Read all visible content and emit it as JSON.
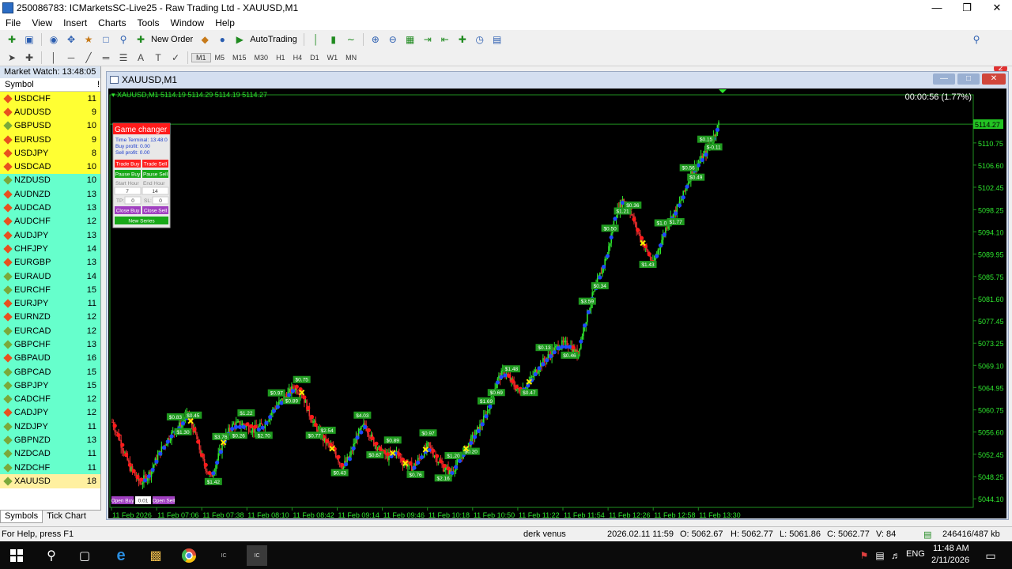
{
  "window": {
    "title": "250086783: ICMarketsSC-Live25 - Raw Trading Ltd - XAUUSD,M1",
    "controls": [
      "minimize",
      "maximize",
      "close"
    ]
  },
  "menu": [
    "File",
    "View",
    "Insert",
    "Charts",
    "Tools",
    "Window",
    "Help"
  ],
  "toolbar": {
    "new_order_label": "New Order",
    "autotrading_label": "AutoTrading",
    "notifications_count": "2"
  },
  "timeframes": [
    "M1",
    "M5",
    "M15",
    "M30",
    "H1",
    "H4",
    "D1",
    "W1",
    "MN"
  ],
  "active_timeframe": "M1",
  "market_watch": {
    "header": "Market Watch: 13:48:05",
    "col_symbol": "Symbol",
    "col_spread": "!",
    "rows": [
      {
        "symbol": "USDCHF",
        "spread": "11",
        "color": "#ffff33",
        "dot": "#e8501e"
      },
      {
        "symbol": "AUDUSD",
        "spread": "9",
        "color": "#ffff33",
        "dot": "#e8501e"
      },
      {
        "symbol": "GBPUSD",
        "spread": "10",
        "color": "#ffff33",
        "dot": "#7aa93a"
      },
      {
        "symbol": "EURUSD",
        "spread": "9",
        "color": "#ffff33",
        "dot": "#e8501e"
      },
      {
        "symbol": "USDJPY",
        "spread": "8",
        "color": "#ffff33",
        "dot": "#e8501e"
      },
      {
        "symbol": "USDCAD",
        "spread": "10",
        "color": "#ffff33",
        "dot": "#e8501e"
      },
      {
        "symbol": "NZDUSD",
        "spread": "10",
        "color": "#66ffcc",
        "dot": "#7aa93a"
      },
      {
        "symbol": "AUDNZD",
        "spread": "13",
        "color": "#66ffcc",
        "dot": "#e8501e"
      },
      {
        "symbol": "AUDCAD",
        "spread": "13",
        "color": "#66ffcc",
        "dot": "#e8501e"
      },
      {
        "symbol": "AUDCHF",
        "spread": "12",
        "color": "#66ffcc",
        "dot": "#e8501e"
      },
      {
        "symbol": "AUDJPY",
        "spread": "13",
        "color": "#66ffcc",
        "dot": "#e8501e"
      },
      {
        "symbol": "CHFJPY",
        "spread": "14",
        "color": "#66ffcc",
        "dot": "#e8501e"
      },
      {
        "symbol": "EURGBP",
        "spread": "13",
        "color": "#66ffcc",
        "dot": "#e8501e"
      },
      {
        "symbol": "EURAUD",
        "spread": "14",
        "color": "#66ffcc",
        "dot": "#7aa93a"
      },
      {
        "symbol": "EURCHF",
        "spread": "15",
        "color": "#66ffcc",
        "dot": "#7aa93a"
      },
      {
        "symbol": "EURJPY",
        "spread": "11",
        "color": "#66ffcc",
        "dot": "#e8501e"
      },
      {
        "symbol": "EURNZD",
        "spread": "12",
        "color": "#66ffcc",
        "dot": "#e8501e"
      },
      {
        "symbol": "EURCAD",
        "spread": "12",
        "color": "#66ffcc",
        "dot": "#7aa93a"
      },
      {
        "symbol": "GBPCHF",
        "spread": "13",
        "color": "#66ffcc",
        "dot": "#7aa93a"
      },
      {
        "symbol": "GBPAUD",
        "spread": "16",
        "color": "#66ffcc",
        "dot": "#e8501e"
      },
      {
        "symbol": "GBPCAD",
        "spread": "15",
        "color": "#66ffcc",
        "dot": "#7aa93a"
      },
      {
        "symbol": "GBPJPY",
        "spread": "15",
        "color": "#66ffcc",
        "dot": "#7aa93a"
      },
      {
        "symbol": "CADCHF",
        "spread": "12",
        "color": "#66ffcc",
        "dot": "#7aa93a"
      },
      {
        "symbol": "CADJPY",
        "spread": "12",
        "color": "#66ffcc",
        "dot": "#e8501e"
      },
      {
        "symbol": "NZDJPY",
        "spread": "11",
        "color": "#66ffcc",
        "dot": "#7aa93a"
      },
      {
        "symbol": "GBPNZD",
        "spread": "13",
        "color": "#66ffcc",
        "dot": "#7aa93a"
      },
      {
        "symbol": "NZDCAD",
        "spread": "11",
        "color": "#66ffcc",
        "dot": "#7aa93a"
      },
      {
        "symbol": "NZDCHF",
        "spread": "11",
        "color": "#66ffcc",
        "dot": "#7aa93a"
      },
      {
        "symbol": "XAUUSD",
        "spread": "18",
        "color": "#fff0a0",
        "dot": "#7aa93a"
      }
    ],
    "tabs": [
      "Symbols",
      "Tick Chart"
    ]
  },
  "chart_window": {
    "title": "XAUUSD,M1",
    "ohlc_line": "XAUUSD,M1  5114.19 5114.29 5114.19 5114.27",
    "timer": "00:00:56 (1.77%)",
    "current_price": "5114.27"
  },
  "panel": {
    "title": "Game changer",
    "time_terminal": "Time Terminal: 13:48:0",
    "buy_profit": "Buy profit: 0.00",
    "sell_profit": "Sell profit: 0.00",
    "trade_buy": "Trade Buy",
    "trade_sell": "Trade Sell",
    "pause_buy": "Pause Buy",
    "pause_sell": "Pause Sell",
    "start_hour_label": "Start Hour",
    "end_hour_label": "End Hour",
    "start_hour": "7",
    "end_hour": "14",
    "tp_label": "TP:",
    "tp_value": "0",
    "sl_label": "SL:",
    "sl_value": "0",
    "close_buy": "Close Buy",
    "close_sell": "Close Sell",
    "new_series": "New Series",
    "open_buy": "Open Buy",
    "lot": "0.01",
    "open_sell": "Open Sell"
  },
  "chart_data": {
    "type": "candlestick",
    "symbol": "XAUUSD",
    "timeframe": "M1",
    "y_ticks": [
      "5110.75",
      "5106.60",
      "5102.45",
      "5098.25",
      "5094.10",
      "5089.95",
      "5085.75",
      "5081.60",
      "5077.45",
      "5073.25",
      "5069.10",
      "5064.95",
      "5060.75",
      "5056.60",
      "5052.45",
      "5048.25",
      "5044.10"
    ],
    "x_ticks": [
      "11 Feb 2026",
      "11 Feb 07:06",
      "11 Feb 07:38",
      "11 Feb 08:10",
      "11 Feb 08:42",
      "11 Feb 09:14",
      "11 Feb 09:46",
      "11 Feb 10:18",
      "11 Feb 10:50",
      "11 Feb 11:22",
      "11 Feb 11:54",
      "11 Feb 12:26",
      "11 Feb 12:58",
      "11 Feb 13:30"
    ],
    "ylim": [
      5042.5,
      5116.5
    ],
    "trend": [
      [
        0,
        5058.5
      ],
      [
        6,
        5055
      ],
      [
        14,
        5050
      ],
      [
        22,
        5047
      ],
      [
        30,
        5049
      ],
      [
        38,
        5053
      ],
      [
        46,
        5056
      ],
      [
        54,
        5058
      ],
      [
        60,
        5060
      ],
      [
        66,
        5056
      ],
      [
        72,
        5051
      ],
      [
        78,
        5048
      ],
      [
        84,
        5052
      ],
      [
        90,
        5056
      ],
      [
        96,
        5058
      ],
      [
        104,
        5058
      ],
      [
        112,
        5057
      ],
      [
        120,
        5058
      ],
      [
        128,
        5061
      ],
      [
        136,
        5063
      ],
      [
        144,
        5065
      ],
      [
        150,
        5064
      ],
      [
        156,
        5060
      ],
      [
        162,
        5057
      ],
      [
        168,
        5055
      ],
      [
        176,
        5053
      ],
      [
        182,
        5050
      ],
      [
        188,
        5052
      ],
      [
        194,
        5056
      ],
      [
        200,
        5058
      ],
      [
        206,
        5055
      ],
      [
        212,
        5053
      ],
      [
        218,
        5052
      ],
      [
        224,
        5053
      ],
      [
        230,
        5051
      ],
      [
        238,
        5050
      ],
      [
        244,
        5052
      ],
      [
        250,
        5054
      ],
      [
        256,
        5052
      ],
      [
        262,
        5050
      ],
      [
        268,
        5049
      ],
      [
        276,
        5052
      ],
      [
        284,
        5055
      ],
      [
        292,
        5058
      ],
      [
        298,
        5061
      ],
      [
        304,
        5066
      ],
      [
        310,
        5068
      ],
      [
        316,
        5066
      ],
      [
        322,
        5064
      ],
      [
        330,
        5066
      ],
      [
        338,
        5069
      ],
      [
        346,
        5071
      ],
      [
        354,
        5073
      ],
      [
        362,
        5073
      ],
      [
        368,
        5071
      ],
      [
        374,
        5077
      ],
      [
        380,
        5082
      ],
      [
        386,
        5086
      ],
      [
        392,
        5090
      ],
      [
        398,
        5097
      ],
      [
        404,
        5100
      ],
      [
        410,
        5098
      ],
      [
        416,
        5094
      ],
      [
        422,
        5091
      ],
      [
        428,
        5088
      ],
      [
        434,
        5092
      ],
      [
        440,
        5096
      ],
      [
        446,
        5098
      ],
      [
        452,
        5101
      ],
      [
        458,
        5105
      ],
      [
        464,
        5107
      ],
      [
        470,
        5109
      ],
      [
        476,
        5112
      ],
      [
        480,
        5114.2
      ]
    ]
  },
  "status": {
    "help": "For Help, press F1",
    "profile": "derk venus",
    "datetime": "2026.02.11 11:59",
    "open": "O: 5062.67",
    "high": "H: 5062.77",
    "low": "L: 5061.86",
    "close": "C: 5062.77",
    "volume": "V: 84",
    "traffic": "246416/487 kb"
  },
  "taskbar": {
    "lang": "ENG",
    "time": "11:48 AM",
    "date": "2/11/2026"
  }
}
